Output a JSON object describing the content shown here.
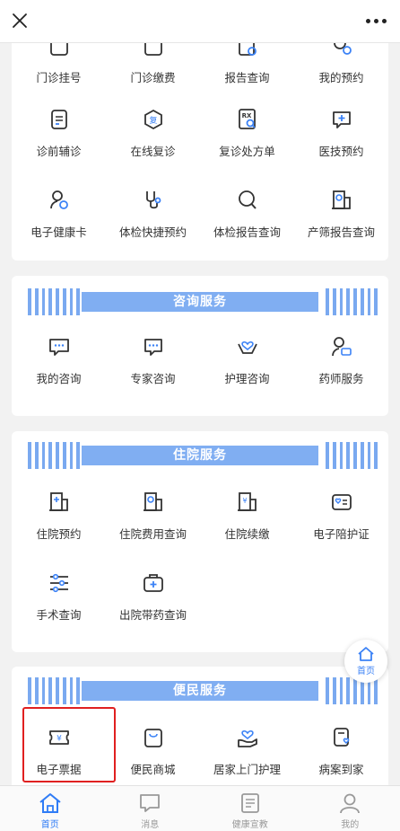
{
  "topbar": {
    "close_icon": "close-icon",
    "more_icon": "more-icon"
  },
  "colors": {
    "accent": "#2f7cf6",
    "banner": "#80aef2",
    "highlight": "#e02020"
  },
  "top_card": {
    "row1": [
      "门诊挂号",
      "门诊缴费",
      "报告查询",
      "我的预约"
    ],
    "row2": [
      "诊前辅诊",
      "在线复诊",
      "复诊处方单",
      "医技预约"
    ],
    "row3": [
      "电子健康卡",
      "体检快捷预约",
      "体检报告查询",
      "产筛报告查询"
    ]
  },
  "consult": {
    "title": "咨询服务",
    "items": [
      "我的咨询",
      "专家咨询",
      "护理咨询",
      "药师服务"
    ]
  },
  "inpatient": {
    "title": "住院服务",
    "row1": [
      "住院预约",
      "住院费用查询",
      "住院续缴",
      "电子陪护证"
    ],
    "row2": [
      "手术查询",
      "出院带药查询"
    ]
  },
  "convenience": {
    "title": "便民服务",
    "items": [
      "电子票据",
      "便民商城",
      "居家上门护理",
      "病案到家"
    ]
  },
  "float_home": {
    "label": "首页"
  },
  "tabbar": [
    "首页",
    "消息",
    "健康宣教",
    "我的"
  ]
}
